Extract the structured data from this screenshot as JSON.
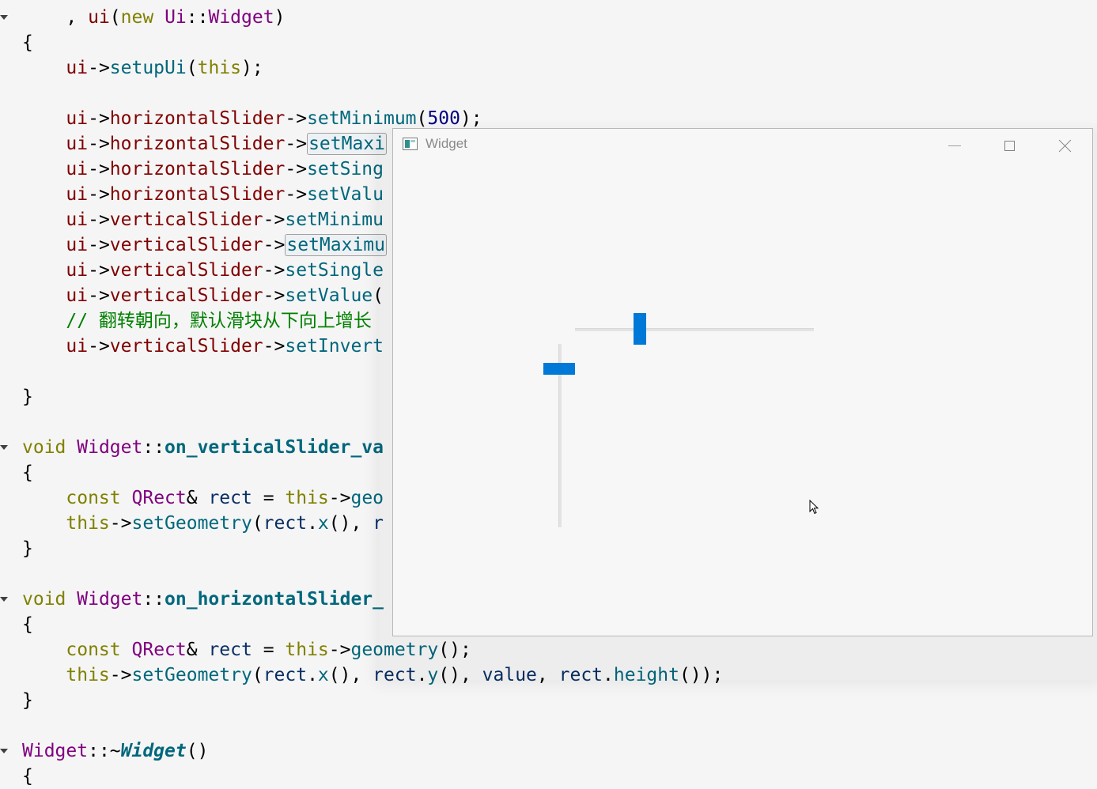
{
  "editor": {
    "lines": [
      {
        "fold": true,
        "tokens": [
          {
            "c": "pl",
            "t": "    , "
          },
          {
            "c": "mem",
            "t": "ui"
          },
          {
            "c": "pl",
            "t": "("
          },
          {
            "c": "kw",
            "t": "new"
          },
          {
            "c": "pl",
            "t": " "
          },
          {
            "c": "ty",
            "t": "Ui"
          },
          {
            "c": "pl",
            "t": "::"
          },
          {
            "c": "ty",
            "t": "Widget"
          },
          {
            "c": "pl",
            "t": ")"
          }
        ]
      },
      {
        "fold": false,
        "tokens": [
          {
            "c": "pl",
            "t": "{"
          }
        ]
      },
      {
        "fold": false,
        "tokens": [
          {
            "c": "pl",
            "t": "    "
          },
          {
            "c": "mem",
            "t": "ui"
          },
          {
            "c": "pl",
            "t": "->"
          },
          {
            "c": "fn",
            "t": "setupUi"
          },
          {
            "c": "pl",
            "t": "("
          },
          {
            "c": "kw",
            "t": "this"
          },
          {
            "c": "pl",
            "t": ");"
          }
        ]
      },
      {
        "fold": false,
        "tokens": []
      },
      {
        "fold": false,
        "tokens": [
          {
            "c": "pl",
            "t": "    "
          },
          {
            "c": "mem",
            "t": "ui"
          },
          {
            "c": "pl",
            "t": "->"
          },
          {
            "c": "mem",
            "t": "horizontalSlider"
          },
          {
            "c": "pl",
            "t": "->"
          },
          {
            "c": "fn",
            "t": "setMinimum"
          },
          {
            "c": "pl",
            "t": "("
          },
          {
            "c": "num",
            "t": "500"
          },
          {
            "c": "pl",
            "t": ");"
          }
        ]
      },
      {
        "fold": false,
        "tokens": [
          {
            "c": "pl",
            "t": "    "
          },
          {
            "c": "mem",
            "t": "ui"
          },
          {
            "c": "pl",
            "t": "->"
          },
          {
            "c": "mem",
            "t": "horizontalSlider"
          },
          {
            "c": "pl",
            "t": "->"
          },
          {
            "c": "fn hl",
            "t": "setMaxi"
          }
        ]
      },
      {
        "fold": false,
        "tokens": [
          {
            "c": "pl",
            "t": "    "
          },
          {
            "c": "mem",
            "t": "ui"
          },
          {
            "c": "pl",
            "t": "->"
          },
          {
            "c": "mem",
            "t": "horizontalSlider"
          },
          {
            "c": "pl",
            "t": "->"
          },
          {
            "c": "fn",
            "t": "setSing"
          }
        ]
      },
      {
        "fold": false,
        "tokens": [
          {
            "c": "pl",
            "t": "    "
          },
          {
            "c": "mem",
            "t": "ui"
          },
          {
            "c": "pl",
            "t": "->"
          },
          {
            "c": "mem",
            "t": "horizontalSlider"
          },
          {
            "c": "pl",
            "t": "->"
          },
          {
            "c": "fn",
            "t": "setValu"
          }
        ]
      },
      {
        "fold": false,
        "tokens": [
          {
            "c": "pl",
            "t": "    "
          },
          {
            "c": "mem",
            "t": "ui"
          },
          {
            "c": "pl",
            "t": "->"
          },
          {
            "c": "mem",
            "t": "verticalSlider"
          },
          {
            "c": "pl",
            "t": "->"
          },
          {
            "c": "fn",
            "t": "setMinimu"
          }
        ]
      },
      {
        "fold": false,
        "tokens": [
          {
            "c": "pl",
            "t": "    "
          },
          {
            "c": "mem",
            "t": "ui"
          },
          {
            "c": "pl",
            "t": "->"
          },
          {
            "c": "mem",
            "t": "verticalSlider"
          },
          {
            "c": "pl",
            "t": "->"
          },
          {
            "c": "fn hl",
            "t": "setMaximu"
          }
        ]
      },
      {
        "fold": false,
        "tokens": [
          {
            "c": "pl",
            "t": "    "
          },
          {
            "c": "mem",
            "t": "ui"
          },
          {
            "c": "pl",
            "t": "->"
          },
          {
            "c": "mem",
            "t": "verticalSlider"
          },
          {
            "c": "pl",
            "t": "->"
          },
          {
            "c": "fn",
            "t": "setSingle"
          }
        ]
      },
      {
        "fold": false,
        "tokens": [
          {
            "c": "pl",
            "t": "    "
          },
          {
            "c": "mem",
            "t": "ui"
          },
          {
            "c": "pl",
            "t": "->"
          },
          {
            "c": "mem",
            "t": "verticalSlider"
          },
          {
            "c": "pl",
            "t": "->"
          },
          {
            "c": "fn",
            "t": "setValue"
          },
          {
            "c": "pl",
            "t": "("
          }
        ]
      },
      {
        "fold": false,
        "tokens": [
          {
            "c": "pl",
            "t": "    "
          },
          {
            "c": "cmt",
            "t": "// 翻转朝向，默认滑块从下向上增长"
          }
        ]
      },
      {
        "fold": false,
        "tokens": [
          {
            "c": "pl",
            "t": "    "
          },
          {
            "c": "mem",
            "t": "ui"
          },
          {
            "c": "pl",
            "t": "->"
          },
          {
            "c": "mem",
            "t": "verticalSlider"
          },
          {
            "c": "pl",
            "t": "->"
          },
          {
            "c": "fn",
            "t": "setInvert"
          }
        ]
      },
      {
        "fold": false,
        "tokens": []
      },
      {
        "fold": false,
        "tokens": [
          {
            "c": "pl",
            "t": "}"
          }
        ]
      },
      {
        "fold": false,
        "tokens": []
      },
      {
        "fold": true,
        "tokens": [
          {
            "c": "kw",
            "t": "void"
          },
          {
            "c": "pl",
            "t": " "
          },
          {
            "c": "ty",
            "t": "Widget"
          },
          {
            "c": "pl",
            "t": "::"
          },
          {
            "c": "fnb",
            "t": "on_verticalSlider_va"
          }
        ]
      },
      {
        "fold": false,
        "tokens": [
          {
            "c": "pl",
            "t": "{"
          }
        ]
      },
      {
        "fold": false,
        "tokens": [
          {
            "c": "pl",
            "t": "    "
          },
          {
            "c": "kw",
            "t": "const"
          },
          {
            "c": "pl",
            "t": " "
          },
          {
            "c": "ty",
            "t": "QRect"
          },
          {
            "c": "pl",
            "t": "& "
          },
          {
            "c": "var",
            "t": "rect"
          },
          {
            "c": "pl",
            "t": " = "
          },
          {
            "c": "kw",
            "t": "this"
          },
          {
            "c": "pl",
            "t": "->"
          },
          {
            "c": "fn",
            "t": "geo"
          }
        ]
      },
      {
        "fold": false,
        "tokens": [
          {
            "c": "pl",
            "t": "    "
          },
          {
            "c": "kw",
            "t": "this"
          },
          {
            "c": "pl",
            "t": "->"
          },
          {
            "c": "fn",
            "t": "setGeometry"
          },
          {
            "c": "pl",
            "t": "("
          },
          {
            "c": "var",
            "t": "rect"
          },
          {
            "c": "pl",
            "t": "."
          },
          {
            "c": "fn",
            "t": "x"
          },
          {
            "c": "pl",
            "t": "(), "
          },
          {
            "c": "var",
            "t": "r"
          }
        ]
      },
      {
        "fold": false,
        "tokens": [
          {
            "c": "pl",
            "t": "}"
          }
        ]
      },
      {
        "fold": false,
        "tokens": []
      },
      {
        "fold": true,
        "tokens": [
          {
            "c": "kw",
            "t": "void"
          },
          {
            "c": "pl",
            "t": " "
          },
          {
            "c": "ty",
            "t": "Widget"
          },
          {
            "c": "pl",
            "t": "::"
          },
          {
            "c": "fnb",
            "t": "on_horizontalSlider_"
          }
        ]
      },
      {
        "fold": false,
        "tokens": [
          {
            "c": "pl",
            "t": "{"
          }
        ]
      },
      {
        "fold": false,
        "tokens": [
          {
            "c": "pl",
            "t": "    "
          },
          {
            "c": "kw",
            "t": "const"
          },
          {
            "c": "pl",
            "t": " "
          },
          {
            "c": "ty",
            "t": "QRect"
          },
          {
            "c": "pl",
            "t": "& "
          },
          {
            "c": "var",
            "t": "rect"
          },
          {
            "c": "pl",
            "t": " = "
          },
          {
            "c": "kw",
            "t": "this"
          },
          {
            "c": "pl",
            "t": "->"
          },
          {
            "c": "fn",
            "t": "geometry"
          },
          {
            "c": "pl",
            "t": "();"
          }
        ]
      },
      {
        "fold": false,
        "tokens": [
          {
            "c": "pl",
            "t": "    "
          },
          {
            "c": "kw",
            "t": "this"
          },
          {
            "c": "pl",
            "t": "->"
          },
          {
            "c": "fn",
            "t": "setGeometry"
          },
          {
            "c": "pl",
            "t": "("
          },
          {
            "c": "var",
            "t": "rect"
          },
          {
            "c": "pl",
            "t": "."
          },
          {
            "c": "fn",
            "t": "x"
          },
          {
            "c": "pl",
            "t": "(), "
          },
          {
            "c": "var",
            "t": "rect"
          },
          {
            "c": "pl",
            "t": "."
          },
          {
            "c": "fn",
            "t": "y"
          },
          {
            "c": "pl",
            "t": "(), "
          },
          {
            "c": "var",
            "t": "value"
          },
          {
            "c": "pl",
            "t": ", "
          },
          {
            "c": "var",
            "t": "rect"
          },
          {
            "c": "pl",
            "t": "."
          },
          {
            "c": "fn",
            "t": "height"
          },
          {
            "c": "pl",
            "t": "());"
          }
        ]
      },
      {
        "fold": false,
        "tokens": [
          {
            "c": "pl",
            "t": "}"
          }
        ]
      },
      {
        "fold": false,
        "tokens": []
      },
      {
        "fold": true,
        "tokens": [
          {
            "c": "ty",
            "t": "Widget"
          },
          {
            "c": "pl",
            "t": "::~"
          },
          {
            "c": "fni",
            "t": "Widget"
          },
          {
            "c": "pl",
            "t": "()"
          }
        ]
      },
      {
        "fold": false,
        "tokens": [
          {
            "c": "pl",
            "t": "{"
          }
        ]
      }
    ]
  },
  "window": {
    "title": "Widget",
    "icon": "qt-widget-app-icon",
    "minimize_icon": "minimize-icon",
    "maximize_icon": "maximize-icon",
    "close_icon": "close-icon"
  },
  "horizontal_slider": {
    "position_fraction": 0.26,
    "color": "#0078d7"
  },
  "vertical_slider": {
    "position_fraction": 0.11,
    "color": "#0078d7"
  }
}
